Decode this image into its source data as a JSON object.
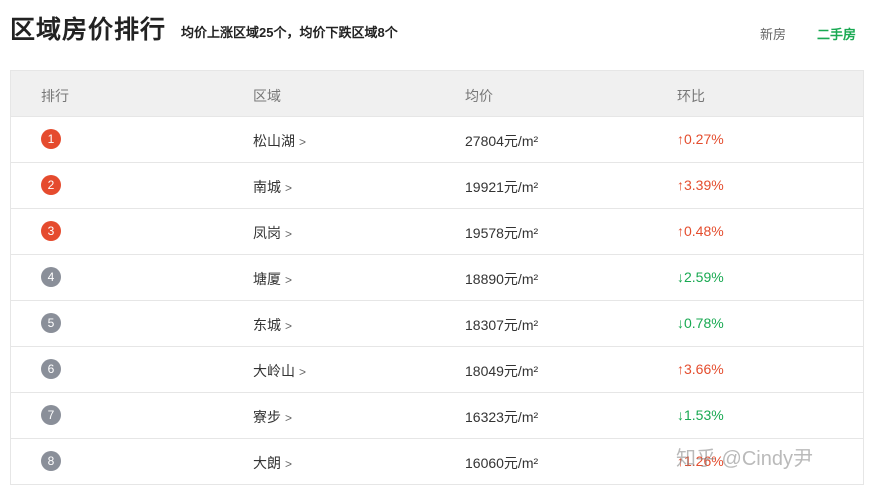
{
  "header": {
    "title": "区域房价排行",
    "summary": "均价上涨区域25个，均价下跌区域8个",
    "tabs": [
      {
        "label": "新房",
        "active": false
      },
      {
        "label": "二手房",
        "active": true
      }
    ]
  },
  "table": {
    "columns": [
      "排行",
      "区域",
      "均价",
      "环比"
    ],
    "rows": [
      {
        "rank": "1",
        "district": "松山湖",
        "price": "27804元/m²",
        "change": "↑0.27%",
        "direction": "up"
      },
      {
        "rank": "2",
        "district": "南城",
        "price": "19921元/m²",
        "change": "↑3.39%",
        "direction": "up"
      },
      {
        "rank": "3",
        "district": "凤岗",
        "price": "19578元/m²",
        "change": "↑0.48%",
        "direction": "up"
      },
      {
        "rank": "4",
        "district": "塘厦",
        "price": "18890元/m²",
        "change": "↓2.59%",
        "direction": "down"
      },
      {
        "rank": "5",
        "district": "东城",
        "price": "18307元/m²",
        "change": "↓0.78%",
        "direction": "down"
      },
      {
        "rank": "6",
        "district": "大岭山",
        "price": "18049元/m²",
        "change": "↑3.66%",
        "direction": "up"
      },
      {
        "rank": "7",
        "district": "寮步",
        "price": "16323元/m²",
        "change": "↓1.53%",
        "direction": "down"
      },
      {
        "rank": "8",
        "district": "大朗",
        "price": "16060元/m²",
        "change": "↑1.26%",
        "direction": "up"
      }
    ]
  },
  "colors": {
    "up": "#e44d2e",
    "down": "#19a952",
    "rank_top": "#e54b2e",
    "rank_rest": "#8a8f99",
    "active_tab": "#19a952"
  },
  "icons": {
    "district_link": "chevron-right-icon"
  },
  "watermark": "知乎 @Cindy尹"
}
